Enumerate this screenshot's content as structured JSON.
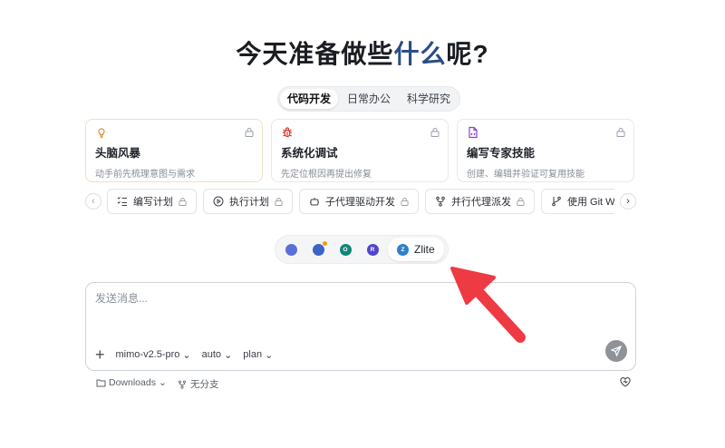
{
  "hero": {
    "title_part1": "今天准备做些",
    "title_highlight": "什么",
    "title_part2": "呢?"
  },
  "tabs": [
    {
      "label": "代码开发",
      "active": true
    },
    {
      "label": "日常办公",
      "active": false
    },
    {
      "label": "科学研究",
      "active": false
    }
  ],
  "cards": [
    {
      "title": "头脑风暴",
      "desc": "动手前先梳理意图与需求",
      "icon": "lightbulb-icon",
      "icon_color": "#e08a2e"
    },
    {
      "title": "系统化调试",
      "desc": "先定位根因再提出修复",
      "icon": "bug-icon",
      "icon_color": "#d9342b"
    },
    {
      "title": "编写专家技能",
      "desc": "创建、编辑并验证可复用技能",
      "icon": "file-code-icon",
      "icon_color": "#8b3fd1"
    }
  ],
  "chips": [
    {
      "label": "编写计划",
      "icon": "list-checks-icon"
    },
    {
      "label": "执行计划",
      "icon": "play-circle-icon"
    },
    {
      "label": "子代理驱动开发",
      "icon": "bot-icon"
    },
    {
      "label": "并行代理派发",
      "icon": "git-fork-icon"
    },
    {
      "label": "使用 Git Worktree",
      "icon": "git-branch-icon"
    }
  ],
  "agents": [
    {
      "initials": "",
      "color": "#5b6fd6"
    },
    {
      "initials": "",
      "color": "#3c64c8"
    },
    {
      "initials": "O",
      "color": "#10857a"
    },
    {
      "initials": "R",
      "color": "#5145cd"
    },
    {
      "initials": "Z",
      "color": "#2f80c9",
      "label": "Zlite",
      "active": true
    }
  ],
  "composer": {
    "placeholder": "发送消息...",
    "model": "mimo-v2.5-pro",
    "mode": "auto",
    "plan": "plan"
  },
  "footer": {
    "folder": "Downloads",
    "branch": "无分支"
  },
  "colors": {
    "accent": "#2a4d85",
    "arrow": "#ee3a43"
  }
}
